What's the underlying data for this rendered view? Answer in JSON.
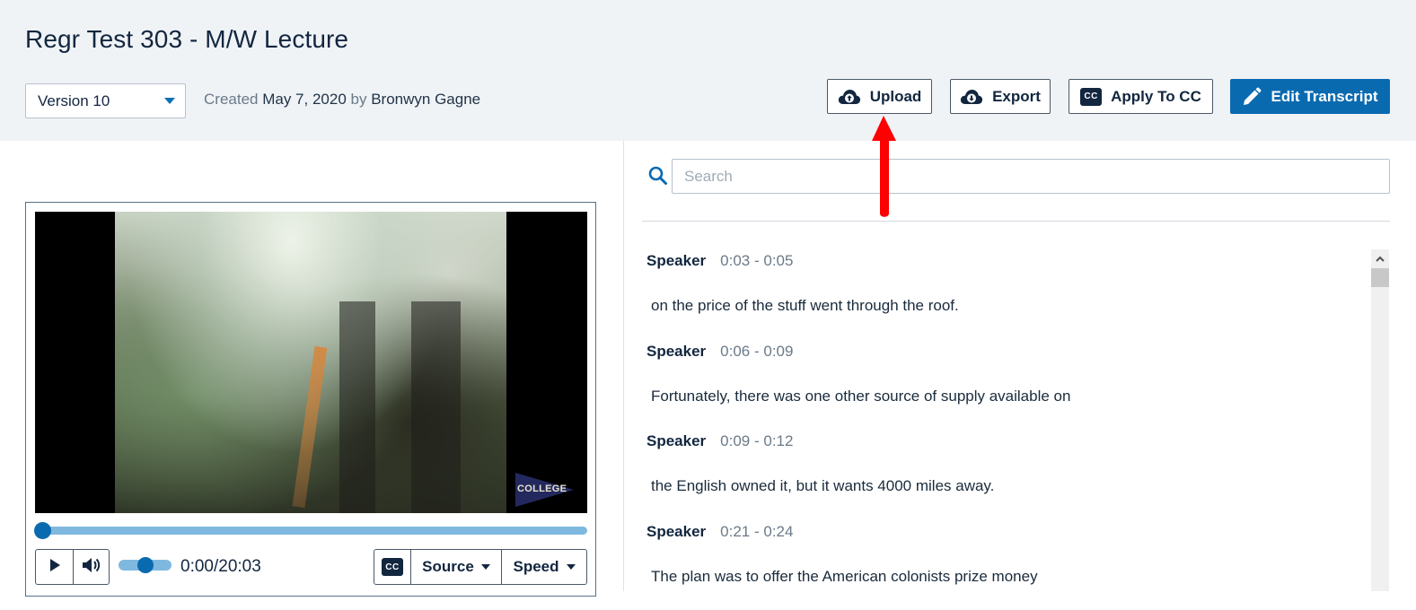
{
  "header": {
    "title": "Regr Test 303 - M/W Lecture",
    "version_select": {
      "selected": "Version 10"
    },
    "created": {
      "label": "Created",
      "date": "May 7, 2020",
      "by_label": "by",
      "author": "Bronwyn Gagne"
    },
    "buttons": {
      "upload": {
        "label": "Upload",
        "icon": "cloud-upload-icon"
      },
      "export": {
        "label": "Export",
        "icon": "cloud-download-icon"
      },
      "apply_cc": {
        "label": "Apply To CC",
        "icon": "cc-icon",
        "badge": "CC"
      },
      "edit_transcript": {
        "label": "Edit Transcript",
        "icon": "pencil-icon"
      }
    }
  },
  "player": {
    "video_watermark": "COLLEGE",
    "progress_fraction": 0.0,
    "volume_fraction": 0.5,
    "time_readout": "0:00/20:03",
    "controls": {
      "play_icon": "play-icon",
      "volume_icon": "volume-icon",
      "cc_badge": "CC",
      "source_label": "Source",
      "speed_label": "Speed"
    }
  },
  "transcript": {
    "search_placeholder": "Search",
    "segments": [
      {
        "speaker": "Speaker",
        "time": "0:03 - 0:05",
        "text": "on the price of the stuff went through the roof."
      },
      {
        "speaker": "Speaker",
        "time": "0:06 - 0:09",
        "text": "Fortunately, there was one other source of supply available on"
      },
      {
        "speaker": "Speaker",
        "time": "0:09 - 0:12",
        "text": "the English owned it, but it wants 4000 miles away."
      },
      {
        "speaker": "Speaker",
        "time": "0:21 - 0:24",
        "text": "The plan was to offer the American colonists prize money"
      }
    ]
  },
  "colors": {
    "accent": "#0a6ab0",
    "header_bg": "#f0f3f6",
    "text_dark": "#12263f",
    "annotation_arrow": "#ff0000"
  }
}
